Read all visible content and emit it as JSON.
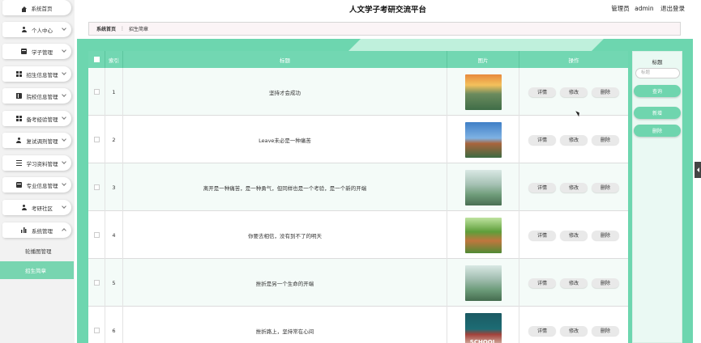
{
  "header": {
    "title": "人文学子考研交流平台",
    "user_role": "管理员",
    "username": "admin",
    "logout": "退出登录"
  },
  "sidebar": {
    "items": [
      {
        "label": "系统首页"
      },
      {
        "label": "个人中心"
      },
      {
        "label": "学子管理"
      },
      {
        "label": "招生信息管理"
      },
      {
        "label": "院校信息管理"
      },
      {
        "label": "备考经验管理"
      },
      {
        "label": "复试调剂管理"
      },
      {
        "label": "学习资料管理"
      },
      {
        "label": "专业信息管理"
      },
      {
        "label": "考研社区"
      },
      {
        "label": "系统管理"
      }
    ],
    "subitems": [
      {
        "label": "轮播图管理"
      },
      {
        "label": "招生简章"
      }
    ]
  },
  "breadcrumb": {
    "home": "系统首页",
    "separator": "⋮",
    "current": "招生简章"
  },
  "table": {
    "headers": {
      "index": "索引",
      "title": "标题",
      "image": "图片",
      "actions": "操作"
    },
    "actions": {
      "detail": "详情",
      "edit": "修改",
      "delete": "删除"
    },
    "rows": [
      {
        "index": "1",
        "title": "坚持才会成功"
      },
      {
        "index": "2",
        "title": "Leave未必是一种痛苦"
      },
      {
        "index": "3",
        "title": "离开是一种痛苦，是一种勇气，但同样也是一个考验，是一个新的开端"
      },
      {
        "index": "4",
        "title": "你要去相信，没有到不了的明天"
      },
      {
        "index": "5",
        "title": "挫折是另一个生命的开端"
      },
      {
        "index": "6",
        "title": "挫折路上，坚持常在心间"
      }
    ]
  },
  "search_panel": {
    "label": "标题",
    "placeholder": "标题",
    "search": "查询",
    "add": "新增",
    "delete": "删除"
  },
  "thumb_text": {
    "school": "SCHOOL"
  }
}
